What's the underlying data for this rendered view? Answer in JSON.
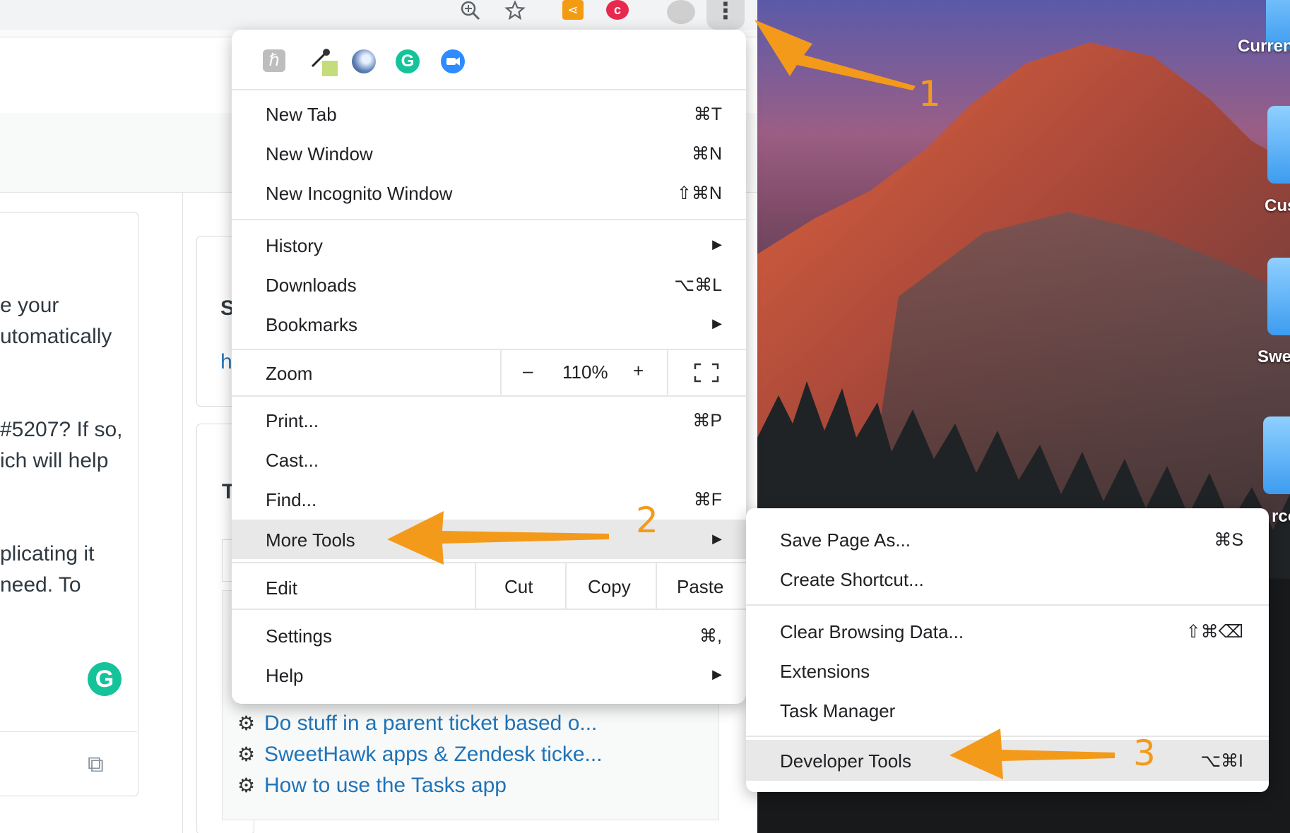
{
  "desktop": {
    "labels": [
      "Curren",
      "Cus",
      "Swe",
      "rco"
    ]
  },
  "page": {
    "left_text": [
      "e your",
      "utomatically",
      "#5207? If so,",
      "ich will help",
      "plicating it",
      "need. To"
    ],
    "side_fragments": [
      "S",
      "h",
      "T"
    ],
    "links": [
      "Do stuff in a parent ticket based o...",
      "SweetHawk apps & Zendesk ticke...",
      "How to use the Tasks app"
    ]
  },
  "menu": {
    "extensions": [
      "h-icon",
      "eyedropper-icon",
      "sphere-icon",
      "grammarly-icon",
      "zoom-video-icon"
    ],
    "items": {
      "new_tab": {
        "label": "New Tab",
        "shortcut": "⌘T"
      },
      "new_window": {
        "label": "New Window",
        "shortcut": "⌘N"
      },
      "new_incognito": {
        "label": "New Incognito Window",
        "shortcut": "⇧⌘N"
      },
      "history": {
        "label": "History"
      },
      "downloads": {
        "label": "Downloads",
        "shortcut": "⌥⌘L"
      },
      "bookmarks": {
        "label": "Bookmarks"
      },
      "zoom": {
        "label": "Zoom",
        "minus": "–",
        "value": "110%",
        "plus": "+"
      },
      "print": {
        "label": "Print...",
        "shortcut": "⌘P"
      },
      "cast": {
        "label": "Cast..."
      },
      "find": {
        "label": "Find...",
        "shortcut": "⌘F"
      },
      "more_tools": {
        "label": "More Tools"
      },
      "edit": {
        "label": "Edit",
        "cut": "Cut",
        "copy": "Copy",
        "paste": "Paste"
      },
      "settings": {
        "label": "Settings",
        "shortcut": "⌘,"
      },
      "help": {
        "label": "Help"
      }
    }
  },
  "submenu": {
    "save_page": {
      "label": "Save Page As...",
      "shortcut": "⌘S"
    },
    "create_shortcut": {
      "label": "Create Shortcut..."
    },
    "clear_data": {
      "label": "Clear Browsing Data...",
      "shortcut": "⇧⌘⌫"
    },
    "extensions": {
      "label": "Extensions"
    },
    "task_manager": {
      "label": "Task Manager"
    },
    "developer_tools": {
      "label": "Developer Tools",
      "shortcut": "⌥⌘I"
    }
  },
  "annotations": {
    "step1": "1",
    "step2": "2",
    "step3": "3",
    "arrow_color": "#f49a1a"
  }
}
